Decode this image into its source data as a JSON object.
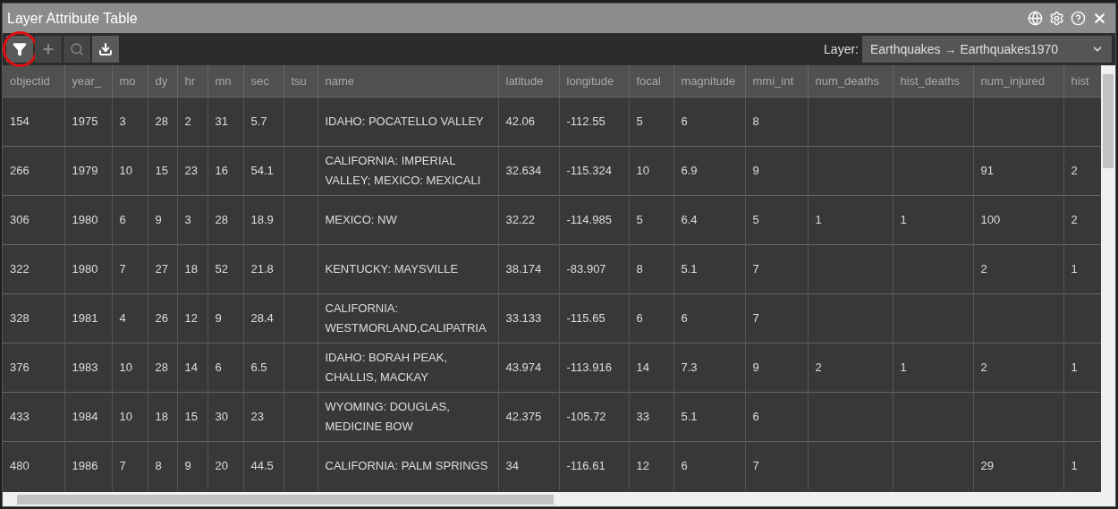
{
  "window": {
    "title": "Layer Attribute Table",
    "actions": [
      {
        "kind": "globe"
      },
      {
        "kind": "settings"
      },
      {
        "kind": "help"
      },
      {
        "kind": "close"
      }
    ]
  },
  "toolbar": {
    "buttons": [
      {
        "kind": "filter",
        "disabled": false,
        "circled": true
      },
      {
        "kind": "move",
        "disabled": true,
        "circled": false
      },
      {
        "kind": "search",
        "disabled": true,
        "circled": false
      },
      {
        "kind": "download",
        "disabled": false,
        "circled": false
      }
    ],
    "layer": {
      "label": "Layer:",
      "value": "Earthquakes → Earthquakes1970"
    }
  },
  "table": {
    "columns": [
      "objectid",
      "year_",
      "mo",
      "dy",
      "hr",
      "mn",
      "sec",
      "tsu",
      "name",
      "latitude",
      "longitude",
      "focal",
      "magnitude",
      "mmi_int",
      "num_deaths",
      "hist_deaths",
      "num_injured",
      "hist"
    ],
    "rows": [
      [
        "154",
        "1975",
        "3",
        "28",
        "2",
        "31",
        "5.7",
        null,
        "IDAHO: POCATELLO VALLEY",
        "42.06",
        "-112.55",
        "5",
        "6",
        "8",
        null,
        null,
        null,
        null
      ],
      [
        "266",
        "1979",
        "10",
        "15",
        "23",
        "16",
        "54.1",
        null,
        "CALIFORNIA: IMPERIAL VALLEY; MEXICO: MEXICALI",
        "32.634",
        "-115.324",
        "10",
        "6.9",
        "9",
        null,
        null,
        "91",
        "2"
      ],
      [
        "306",
        "1980",
        "6",
        "9",
        "3",
        "28",
        "18.9",
        null,
        "MEXICO: NW",
        "32.22",
        "-114.985",
        "5",
        "6.4",
        "5",
        "1",
        "1",
        "100",
        "2"
      ],
      [
        "322",
        "1980",
        "7",
        "27",
        "18",
        "52",
        "21.8",
        null,
        "KENTUCKY: MAYSVILLE",
        "38.174",
        "-83.907",
        "8",
        "5.1",
        "7",
        null,
        null,
        "2",
        "1"
      ],
      [
        "328",
        "1981",
        "4",
        "26",
        "12",
        "9",
        "28.4",
        null,
        "CALIFORNIA: WESTMORLAND,CALIPATRIA",
        "33.133",
        "-115.65",
        "6",
        "6",
        "7",
        null,
        null,
        null,
        null
      ],
      [
        "376",
        "1983",
        "10",
        "28",
        "14",
        "6",
        "6.5",
        null,
        "IDAHO: BORAH PEAK, CHALLIS, MACKAY",
        "43.974",
        "-113.916",
        "14",
        "7.3",
        "9",
        "2",
        "1",
        "2",
        "1"
      ],
      [
        "433",
        "1984",
        "10",
        "18",
        "15",
        "30",
        "23",
        null,
        "WYOMING: DOUGLAS, MEDICINE BOW",
        "42.375",
        "-105.72",
        "33",
        "5.1",
        "6",
        null,
        null,
        null,
        null
      ],
      [
        "480",
        "1986",
        "7",
        "8",
        "9",
        "20",
        "44.5",
        null,
        "CALIFORNIA: PALM SPRINGS",
        "34",
        "-116.61",
        "12",
        "6",
        "7",
        null,
        null,
        "29",
        "1"
      ]
    ]
  }
}
